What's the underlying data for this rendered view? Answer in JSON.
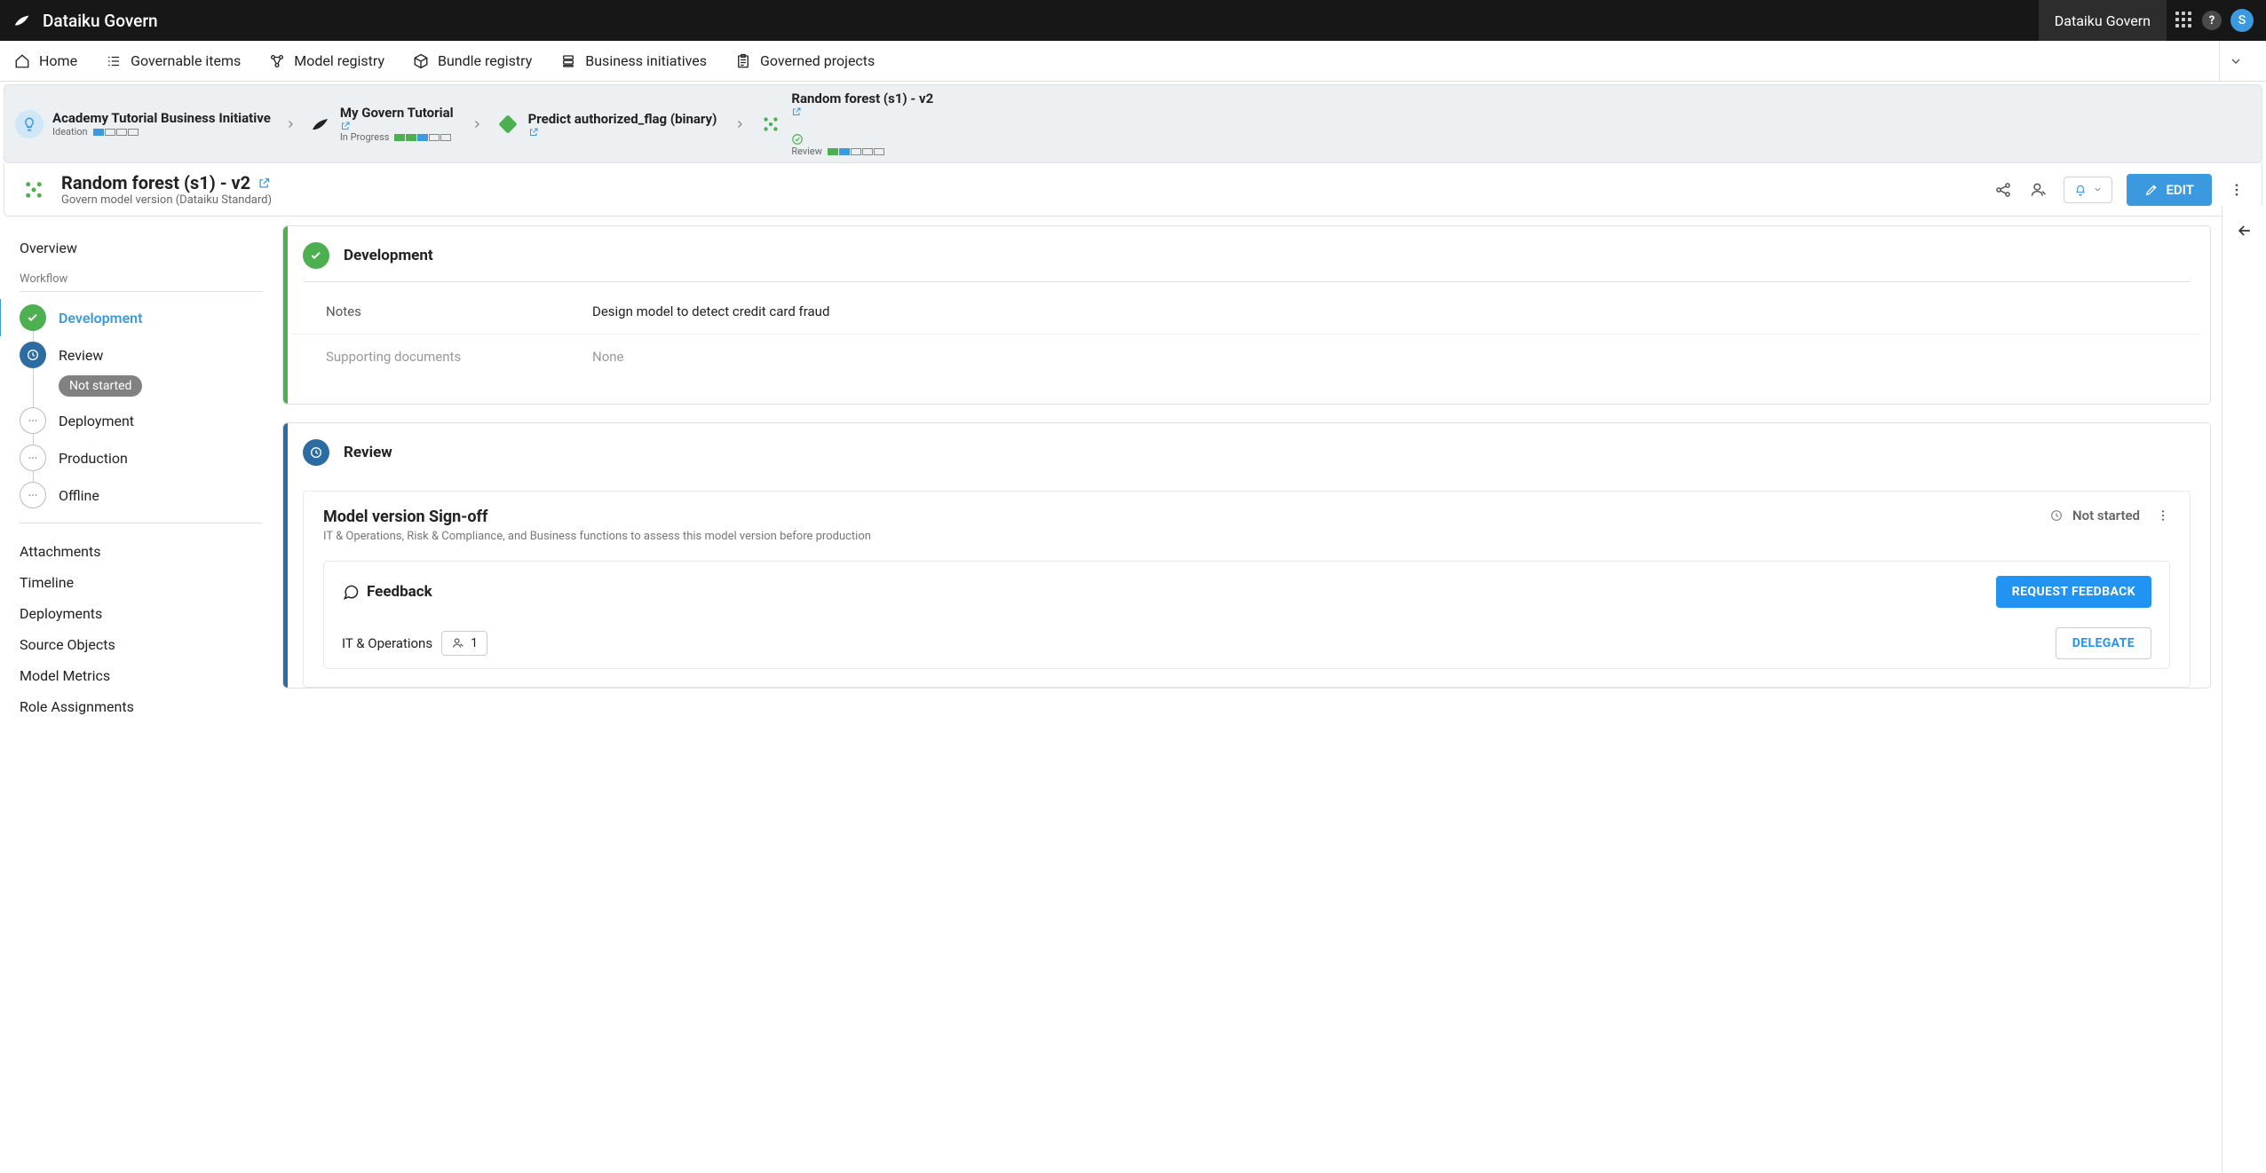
{
  "topbar": {
    "app_title": "Dataiku Govern",
    "instance_label": "Dataiku Govern",
    "avatar_initial": "S"
  },
  "nav": {
    "home": "Home",
    "governable_items": "Governable items",
    "model_registry": "Model registry",
    "bundle_registry": "Bundle registry",
    "business_initiatives": "Business initiatives",
    "governed_projects": "Governed projects"
  },
  "breadcrumb": {
    "items": [
      {
        "title": "Academy Tutorial Business Initiative",
        "sub": "Ideation",
        "progress": [
          true,
          false,
          false,
          false
        ],
        "progress_color": "#3b99e0",
        "icon": "lightbulb",
        "icon_bg": "#cfe7f7"
      },
      {
        "title": "My Govern Tutorial",
        "sub": "In Progress",
        "progress": [
          true,
          true,
          true,
          false,
          false
        ],
        "progress_color": "#4caf50",
        "mid_blue": 3,
        "icon": "bird",
        "ext": true
      },
      {
        "title": "Predict authorized_flag (binary)",
        "sub": "",
        "icon": "model-green",
        "ext": true
      },
      {
        "title": "Random forest (s1) - v2",
        "sub": "Review",
        "progress": [
          true,
          true,
          false,
          false,
          false
        ],
        "progress_color": "#4caf50",
        "icon": "model-version",
        "ext": true,
        "check": true
      }
    ]
  },
  "page": {
    "title": "Random forest (s1) - v2",
    "subtitle": "Govern model version (Dataiku Standard)",
    "edit_label": "EDIT"
  },
  "sidebar": {
    "overview": "Overview",
    "workflow_label": "Workflow",
    "workflow": [
      {
        "label": "Development",
        "status": "done",
        "active": true
      },
      {
        "label": "Review",
        "status": "inprogress",
        "badge": "Not started"
      },
      {
        "label": "Deployment",
        "status": "pending"
      },
      {
        "label": "Production",
        "status": "pending"
      },
      {
        "label": "Offline",
        "status": "pending"
      }
    ],
    "links": {
      "attachments": "Attachments",
      "timeline": "Timeline",
      "deployments": "Deployments",
      "source_objects": "Source Objects",
      "model_metrics": "Model Metrics",
      "role_assignments": "Role Assignments"
    }
  },
  "development": {
    "title": "Development",
    "notes_label": "Notes",
    "notes_value": "Design model to detect credit card fraud",
    "docs_label": "Supporting documents",
    "docs_value": "None"
  },
  "review": {
    "title": "Review",
    "signoff_title": "Model version Sign-off",
    "signoff_desc": "IT & Operations, Risk & Compliance, and Business functions to assess this model version before production",
    "status": "Not started",
    "feedback_title": "Feedback",
    "request_label": "REQUEST FEEDBACK",
    "role1": "IT & Operations",
    "assignee_count": "1",
    "delegate_label": "DELEGATE"
  },
  "colors": {
    "green": "#4caf50",
    "blue": "#2d6ca2",
    "primary": "#3b99e0"
  }
}
